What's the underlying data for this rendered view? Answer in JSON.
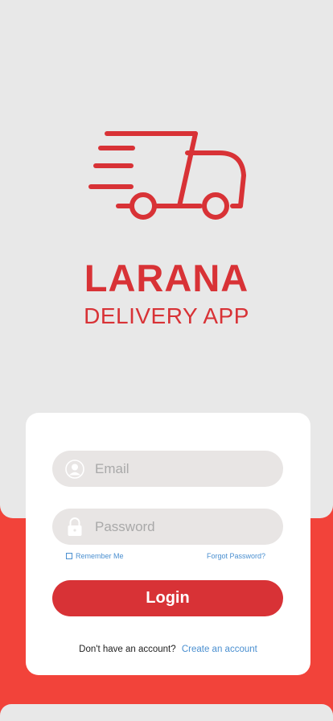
{
  "brand": {
    "name": "LARANA",
    "tagline": "DELIVERY APP",
    "logo_icon": "delivery-truck-icon",
    "color": "#d83236"
  },
  "login": {
    "email_placeholder": "Email",
    "email_icon": "user-avatar-icon",
    "password_placeholder": "Password",
    "password_icon": "lock-icon",
    "remember_label": "Remember Me",
    "forgot_label": "Forgot Password?",
    "login_label": "Login",
    "no_account_text": "Don't have an account?",
    "create_account_label": "Create an account",
    "link_color": "#4a8fd0"
  },
  "theme": {
    "background": "#f2433a",
    "panel": "#e8e8e8",
    "field": "#e8e5e4"
  }
}
